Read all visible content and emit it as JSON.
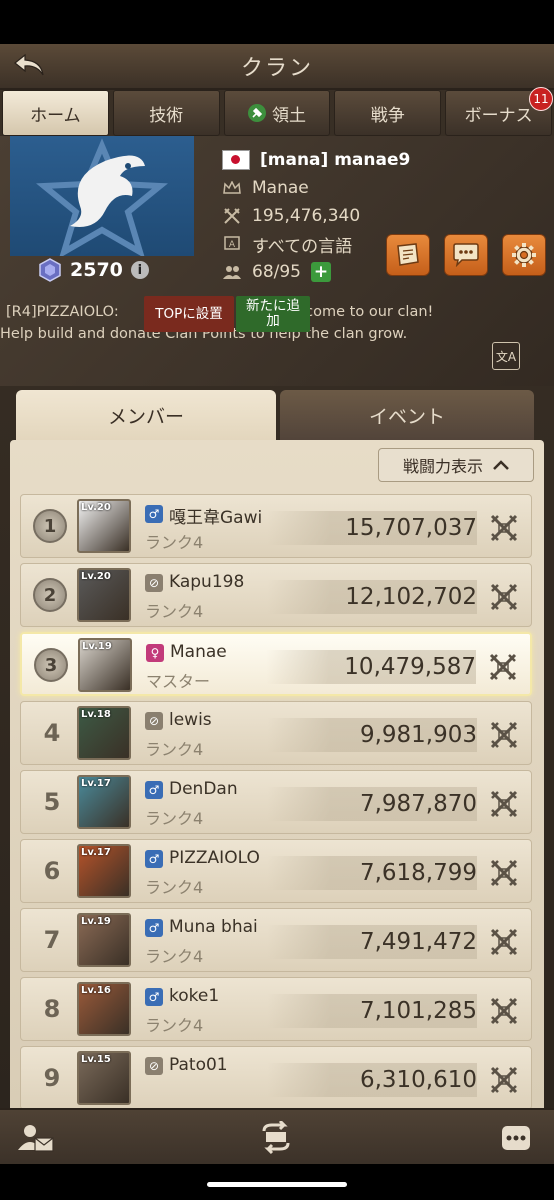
{
  "header": {
    "title": "クラン"
  },
  "tabs": [
    {
      "label": "ホーム",
      "active": true
    },
    {
      "label": "技術"
    },
    {
      "label": "領土"
    },
    {
      "label": "戦争"
    },
    {
      "label": "ボーナス",
      "badge": "11"
    }
  ],
  "clan": {
    "name": "[mana] manae9",
    "leader": "Manae",
    "power": "195,476,340",
    "language": "すべての言語",
    "members": "68/95",
    "score": "2570",
    "info_glyph": "i"
  },
  "announcement": {
    "line1_prefix": "[R4]PIZZAIOLO:",
    "line1_suffix": "Welcome to our clan!",
    "line2": "Help build and donate Clan Points to help the clan grow.",
    "top_button": "TOPに設置",
    "new_button": "新たに追加",
    "translate_label": "文A"
  },
  "subtabs": {
    "members": "メンバー",
    "events": "イベント"
  },
  "sort_button": "戦闘力表示",
  "members": [
    {
      "rank": "1",
      "level": "Lv.20",
      "gender": "male",
      "name": "嘎王韋Gawi",
      "role": "ランク4",
      "power": "15,707,037"
    },
    {
      "rank": "2",
      "level": "Lv.20",
      "gender": "none",
      "name": "Kapu198",
      "role": "ランク4",
      "power": "12,102,702"
    },
    {
      "rank": "3",
      "level": "Lv.19",
      "gender": "female",
      "name": "Manae",
      "role": "マスター",
      "power": "10,479,587",
      "highlight": true
    },
    {
      "rank": "4",
      "level": "Lv.18",
      "gender": "none",
      "name": "lewis",
      "role": "ランク4",
      "power": "9,981,903"
    },
    {
      "rank": "5",
      "level": "Lv.17",
      "gender": "male",
      "name": "DenDan",
      "role": "ランク4",
      "power": "7,987,870"
    },
    {
      "rank": "6",
      "level": "Lv.17",
      "gender": "male",
      "name": "PIZZAIOLO",
      "role": "ランク4",
      "power": "7,618,799"
    },
    {
      "rank": "7",
      "level": "Lv.19",
      "gender": "male",
      "name": "Muna bhai",
      "role": "ランク4",
      "power": "7,491,472"
    },
    {
      "rank": "8",
      "level": "Lv.16",
      "gender": "male",
      "name": "koke1",
      "role": "ランク4",
      "power": "7,101,285"
    },
    {
      "rank": "9",
      "level": "Lv.15",
      "gender": "none",
      "name": "Pato01",
      "role": "",
      "power": "6,310,610"
    }
  ],
  "colors": {
    "accent_orange": "#d86f24",
    "male": "#3a6db5",
    "female": "#c23b7a",
    "highlight": "#f4e8a8"
  }
}
